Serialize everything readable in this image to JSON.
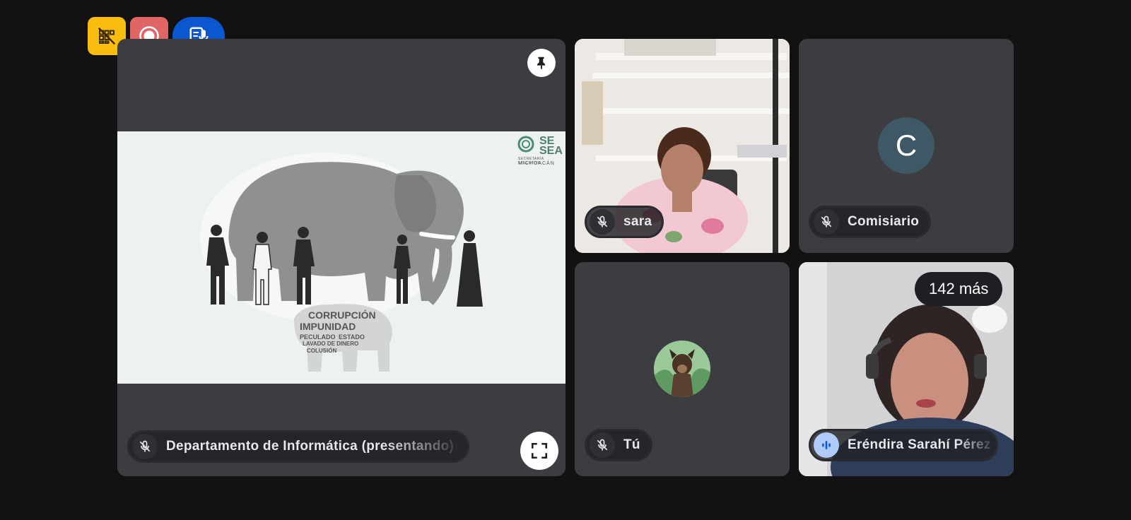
{
  "top_controls": {
    "items": [
      {
        "icon": "grid-off-icon",
        "color": "#f9bd0f"
      },
      {
        "icon": "record-icon",
        "color": "#e06666"
      },
      {
        "icon": "transcription-icon",
        "color": "#0b57d0"
      }
    ]
  },
  "presentation": {
    "presenter_label": "Departamento de Informática (presentando)",
    "slide": {
      "logo_top": "SE",
      "logo_bottom": "SEA",
      "logo_subtitle_1": "SECRETARÍA EJECUTIVA",
      "logo_subtitle_2": "MICHOACÁN",
      "word_cloud": [
        "CORRUPCIÓN",
        "IMPUNIDAD",
        "PECULADO",
        "ESTADO",
        "LAVADO DE DINERO",
        "COLUSIÓN"
      ]
    }
  },
  "participants": {
    "sara": {
      "name": "sara"
    },
    "comisiario": {
      "name": "Comisiario",
      "initial": "C",
      "avatar_color": "#3f5866"
    },
    "self": {
      "name": "Tú"
    },
    "erendira": {
      "name": "Eréndira Sarahí Pérez"
    },
    "more_badge": "142 más"
  }
}
